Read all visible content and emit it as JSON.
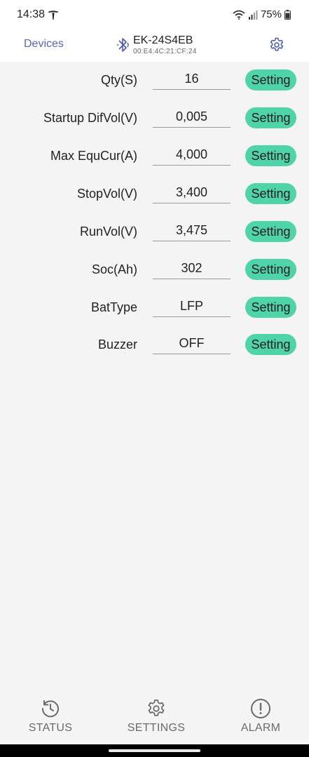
{
  "status_bar": {
    "time": "14:38",
    "battery": "75%"
  },
  "header": {
    "devices_label": "Devices",
    "device_name": "EK-24S4EB",
    "device_mac": "00:E4:4C:21:CF:24"
  },
  "settings": [
    {
      "label": "Qty(S)",
      "value": "16",
      "button": "Setting"
    },
    {
      "label": "Startup DifVol(V)",
      "value": "0,005",
      "button": "Setting"
    },
    {
      "label": "Max EquCur(A)",
      "value": "4,000",
      "button": "Setting"
    },
    {
      "label": "StopVol(V)",
      "value": "3,400",
      "button": "Setting"
    },
    {
      "label": "RunVol(V)",
      "value": "3,475",
      "button": "Setting"
    },
    {
      "label": "Soc(Ah)",
      "value": "302",
      "button": "Setting"
    },
    {
      "label": "BatType",
      "value": "LFP",
      "button": "Setting"
    },
    {
      "label": "Buzzer",
      "value": "OFF",
      "button": "Setting"
    }
  ],
  "bottom_nav": [
    {
      "label": "STATUS",
      "icon": "history-icon"
    },
    {
      "label": "SETTINGS",
      "icon": "gear-icon"
    },
    {
      "label": "ALARM",
      "icon": "alert-icon"
    }
  ],
  "colors": {
    "accent_button": "#4fd4a9",
    "link": "#5b63b7",
    "background": "#f4f4f4"
  }
}
